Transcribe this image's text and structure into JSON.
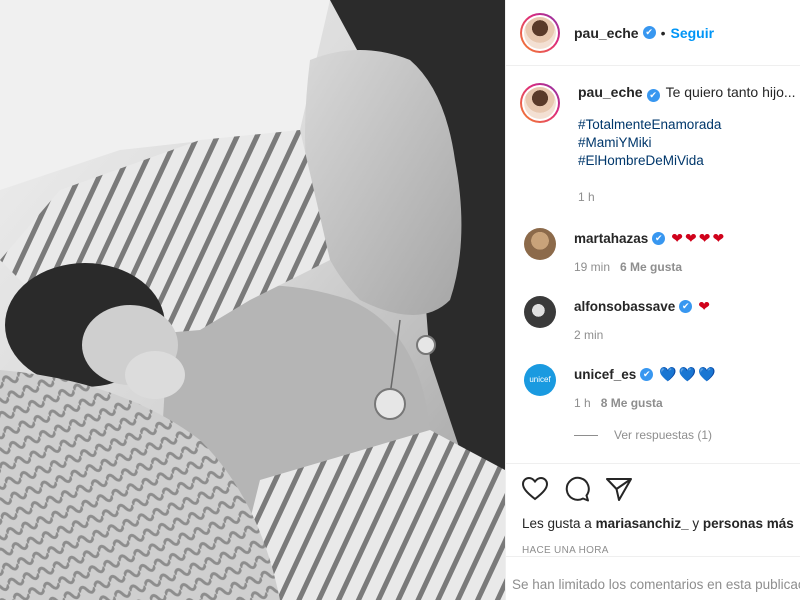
{
  "post": {
    "image_alt": "Black and white photo of a mother nursing her newborn baby"
  },
  "header": {
    "username": "pau_eche",
    "verified_mark": "✔",
    "separator": "•",
    "follow_label": "Seguir"
  },
  "caption": {
    "username": "pau_eche",
    "verified_mark": "✔",
    "text": "Te quiero tanto hijo...",
    "hashtags": [
      "#TotalmenteEnamorada",
      "#MamiYMiki",
      "#ElHombreDeMiVida"
    ],
    "time": "1 h"
  },
  "comments": [
    {
      "username": "martahazas",
      "verified_mark": "✔",
      "text": "❤❤❤❤",
      "time": "19 min",
      "likes": "6 Me gusta",
      "heart_color": "#d0021b"
    },
    {
      "username": "alfonsobassave",
      "verified_mark": "✔",
      "text": "❤",
      "time": "2 min",
      "likes": "",
      "heart_color": "#d0021b"
    },
    {
      "username": "unicef_es",
      "verified_mark": "✔",
      "text": "💙💙💙",
      "time": "1 h",
      "likes": "8 Me gusta",
      "heart_color": "#1565c0",
      "avatar_text": "unicef"
    }
  ],
  "replies_label": "Ver respuestas (1)",
  "actions": {
    "icons": [
      "heart-icon",
      "comment-icon",
      "share-icon"
    ],
    "likes_prefix": "Les gusta a",
    "likes_user": "mariasanchiz_",
    "likes_suffix": "y",
    "likes_more": "personas más",
    "posted_ago": "HACE UNA HORA"
  },
  "footer": {
    "limited_comments": "Se han limitado los comentarios en esta publicación."
  },
  "colors": {
    "accent": "#0095f6",
    "verified": "#3897f0",
    "muted": "#8e8e8e",
    "hashtag": "#00376b"
  }
}
